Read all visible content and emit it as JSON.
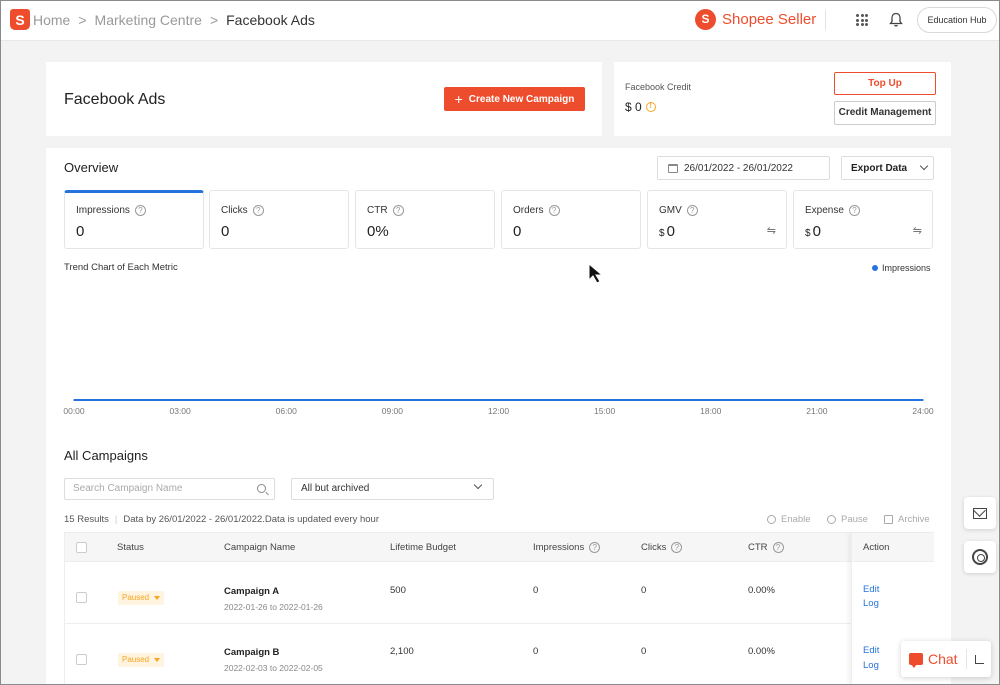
{
  "breadcrumb": {
    "logo_letter": "S",
    "home": "Home",
    "marketing": "Marketing Centre",
    "current": "Facebook Ads",
    "separator": ">"
  },
  "brand": {
    "name": "Shopee Seller",
    "bag_letter": "S",
    "color": "#ee4d2d"
  },
  "topbar": {
    "education_hub": "Education Hub",
    "apps_icon": "grid-icon",
    "notif_icon": "bell-icon"
  },
  "header": {
    "title": "Facebook Ads",
    "create_button": "Create New Campaign",
    "create_plus": "+"
  },
  "credit": {
    "label": "Facebook Credit",
    "value": "$ 0",
    "warn_glyph": "!",
    "topup": "Top Up",
    "management": "Credit Management"
  },
  "overview": {
    "title": "Overview",
    "date_range": "26/01/2022 - 26/01/2022",
    "export": "Export Data",
    "metrics": [
      {
        "label": "Impressions",
        "value": "0",
        "currency": "",
        "active": true
      },
      {
        "label": "Clicks",
        "value": "0",
        "currency": ""
      },
      {
        "label": "CTR",
        "value": "0%",
        "currency": ""
      },
      {
        "label": "Orders",
        "value": "0",
        "currency": ""
      },
      {
        "label": "GMV",
        "value": "0",
        "currency": "$"
      },
      {
        "label": "Expense",
        "value": "0",
        "currency": "$"
      }
    ],
    "help_glyph": "?",
    "swap_glyph": "⇋"
  },
  "chart_data": {
    "type": "line",
    "title": "Trend Chart of Each Metric",
    "x": [
      "00:00",
      "03:00",
      "06:00",
      "09:00",
      "12:00",
      "15:00",
      "18:00",
      "21:00",
      "24:00"
    ],
    "series": [
      {
        "name": "Impressions",
        "values": [
          0,
          0,
          0,
          0,
          0,
          0,
          0,
          0,
          0
        ],
        "color": "#2673dd"
      }
    ],
    "grid": false,
    "legend": "top-right"
  },
  "campaigns": {
    "title": "All Campaigns",
    "search_placeholder": "Search Campaign Name",
    "filter": "All but archived",
    "results_count": "15 Results",
    "results_note": "Data by 26/01/2022 - 26/01/2022.Data is updated every hour",
    "actions": {
      "enable": "Enable",
      "pause": "Pause",
      "archive": "Archive"
    },
    "columns": {
      "status": "Status",
      "name": "Campaign Name",
      "budget": "Lifetime Budget",
      "impressions": "Impressions",
      "clicks": "Clicks",
      "ctr": "CTR",
      "action": "Action"
    },
    "rows": [
      {
        "status": "Paused",
        "name": "Campaign A",
        "dates": "2022-01-26 to 2022-01-26",
        "budget": "500",
        "impressions": "0",
        "clicks": "0",
        "ctr": "0.00%",
        "edit": "Edit",
        "log": "Log"
      },
      {
        "status": "Paused",
        "name": "Campaign B",
        "dates": "2022-02-03 to 2022-02-05",
        "budget": "2,100",
        "impressions": "0",
        "clicks": "0",
        "ctr": "0.00%",
        "edit": "Edit",
        "log": "Log"
      }
    ]
  },
  "chat": {
    "label": "Chat"
  }
}
